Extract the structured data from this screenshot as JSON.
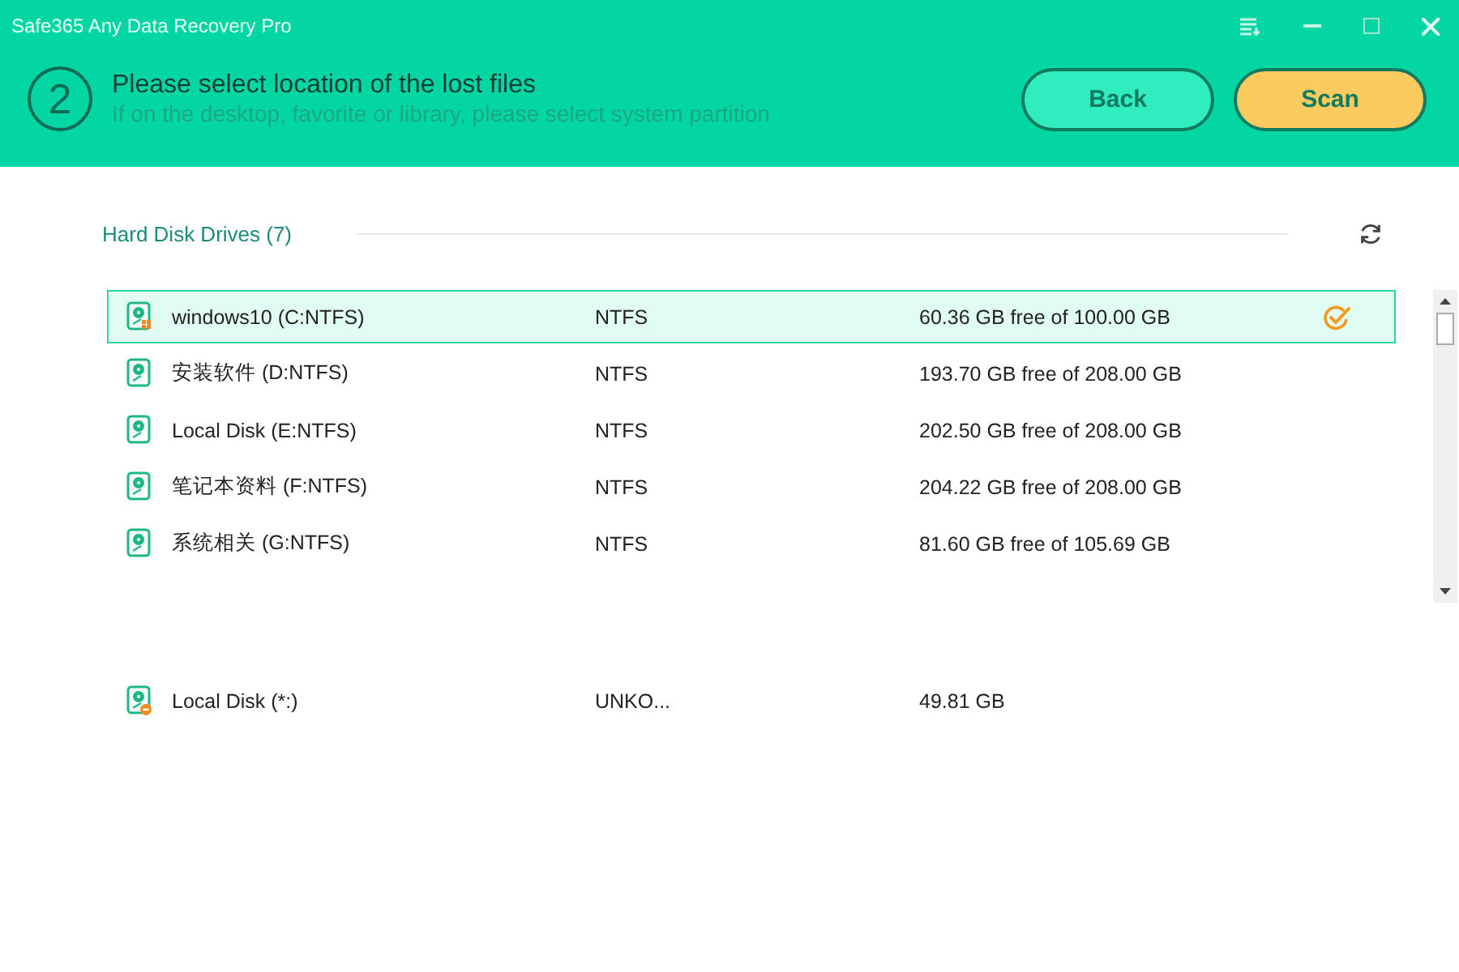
{
  "window": {
    "title": "Safe365 Any Data Recovery Pro"
  },
  "step": {
    "number": "2",
    "title": "Please select location of the lost files",
    "subtitle": "If on the desktop, favorite or library, please select system partition"
  },
  "buttons": [
    {
      "label": "Back",
      "kind": "secondary"
    },
    {
      "label": "Scan",
      "kind": "primary"
    }
  ],
  "section": {
    "title": "Hard Disk Drives (7)"
  },
  "drives": [
    {
      "name": "windows10 (C:NTFS)",
      "fs": "NTFS",
      "space": "60.36 GB free of 100.00 GB",
      "kind": "system",
      "selected": true
    },
    {
      "name": "安装软件 (D:NTFS)",
      "fs": "NTFS",
      "space": "193.70 GB free of 208.00 GB",
      "kind": "disk",
      "selected": false
    },
    {
      "name": "Local Disk (E:NTFS)",
      "fs": "NTFS",
      "space": "202.50 GB free of 208.00 GB",
      "kind": "disk",
      "selected": false
    },
    {
      "name": "笔记本资料 (F:NTFS)",
      "fs": "NTFS",
      "space": "204.22 GB free of 208.00 GB",
      "kind": "disk",
      "selected": false
    },
    {
      "name": "系统相关 (G:NTFS)",
      "fs": "NTFS",
      "space": "81.60 GB free of 105.69 GB",
      "kind": "disk",
      "selected": false
    }
  ],
  "other_drives": [
    {
      "name": "Local Disk (*:)",
      "fs": "UNKO...",
      "space": "49.81 GB",
      "kind": "unknown",
      "selected": false
    }
  ]
}
